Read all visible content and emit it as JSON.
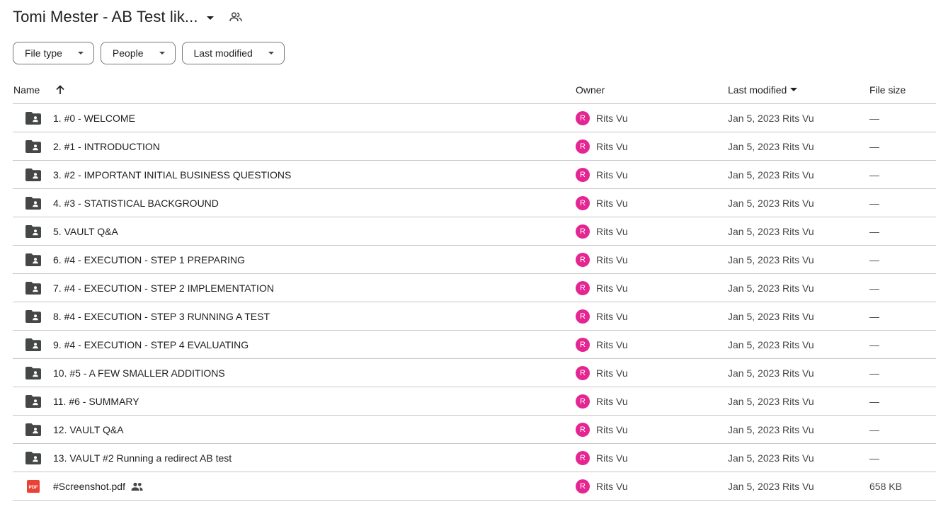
{
  "folder": {
    "title": "Tomi Mester - AB Test lik...",
    "shared_icon": "people-outline-icon"
  },
  "filters": [
    {
      "label": "File type"
    },
    {
      "label": "People"
    },
    {
      "label": "Last modified"
    }
  ],
  "columns": {
    "name": "Name",
    "owner": "Owner",
    "last_modified": "Last modified",
    "file_size": "File size"
  },
  "colors": {
    "avatar": "#e52592",
    "pdf": "#ea4335",
    "folder": "#444746"
  },
  "rows": [
    {
      "name": "1. #0 - WELCOME",
      "type": "shared-folder",
      "owner_initial": "R",
      "owner": "Rits Vu",
      "modified": "Jan 5, 2023 Rits Vu",
      "size": "—"
    },
    {
      "name": "2. #1 - INTRODUCTION",
      "type": "shared-folder",
      "owner_initial": "R",
      "owner": "Rits Vu",
      "modified": "Jan 5, 2023 Rits Vu",
      "size": "—"
    },
    {
      "name": "3. #2 - IMPORTANT INITIAL BUSINESS QUESTIONS",
      "type": "shared-folder",
      "owner_initial": "R",
      "owner": "Rits Vu",
      "modified": "Jan 5, 2023 Rits Vu",
      "size": "—"
    },
    {
      "name": "4. #3 - STATISTICAL BACKGROUND",
      "type": "shared-folder",
      "owner_initial": "R",
      "owner": "Rits Vu",
      "modified": "Jan 5, 2023 Rits Vu",
      "size": "—"
    },
    {
      "name": "5. VAULT Q&A",
      "type": "shared-folder",
      "owner_initial": "R",
      "owner": "Rits Vu",
      "modified": "Jan 5, 2023 Rits Vu",
      "size": "—"
    },
    {
      "name": "6. #4 - EXECUTION - STEP 1 PREPARING",
      "type": "shared-folder",
      "owner_initial": "R",
      "owner": "Rits Vu",
      "modified": "Jan 5, 2023 Rits Vu",
      "size": "—"
    },
    {
      "name": "7. #4 - EXECUTION - STEP 2 IMPLEMENTATION",
      "type": "shared-folder",
      "owner_initial": "R",
      "owner": "Rits Vu",
      "modified": "Jan 5, 2023 Rits Vu",
      "size": "—"
    },
    {
      "name": "8. #4 - EXECUTION - STEP 3 RUNNING A TEST",
      "type": "shared-folder",
      "owner_initial": "R",
      "owner": "Rits Vu",
      "modified": "Jan 5, 2023 Rits Vu",
      "size": "—"
    },
    {
      "name": "9. #4 - EXECUTION - STEP 4 EVALUATING",
      "type": "shared-folder",
      "owner_initial": "R",
      "owner": "Rits Vu",
      "modified": "Jan 5, 2023 Rits Vu",
      "size": "—"
    },
    {
      "name": "10. #5 - A FEW SMALLER ADDITIONS",
      "type": "shared-folder",
      "owner_initial": "R",
      "owner": "Rits Vu",
      "modified": "Jan 5, 2023 Rits Vu",
      "size": "—"
    },
    {
      "name": "11. #6 - SUMMARY",
      "type": "shared-folder",
      "owner_initial": "R",
      "owner": "Rits Vu",
      "modified": "Jan 5, 2023 Rits Vu",
      "size": "—"
    },
    {
      "name": "12. VAULT Q&A",
      "type": "shared-folder",
      "owner_initial": "R",
      "owner": "Rits Vu",
      "modified": "Jan 5, 2023 Rits Vu",
      "size": "—"
    },
    {
      "name": "13. VAULT #2 Running a redirect AB test",
      "type": "shared-folder",
      "owner_initial": "R",
      "owner": "Rits Vu",
      "modified": "Jan 5, 2023 Rits Vu",
      "size": "—"
    },
    {
      "name": "#Screenshot.pdf",
      "type": "pdf",
      "shared": true,
      "owner_initial": "R",
      "owner": "Rits Vu",
      "modified": "Jan 5, 2023 Rits Vu",
      "size": "658 KB"
    }
  ]
}
